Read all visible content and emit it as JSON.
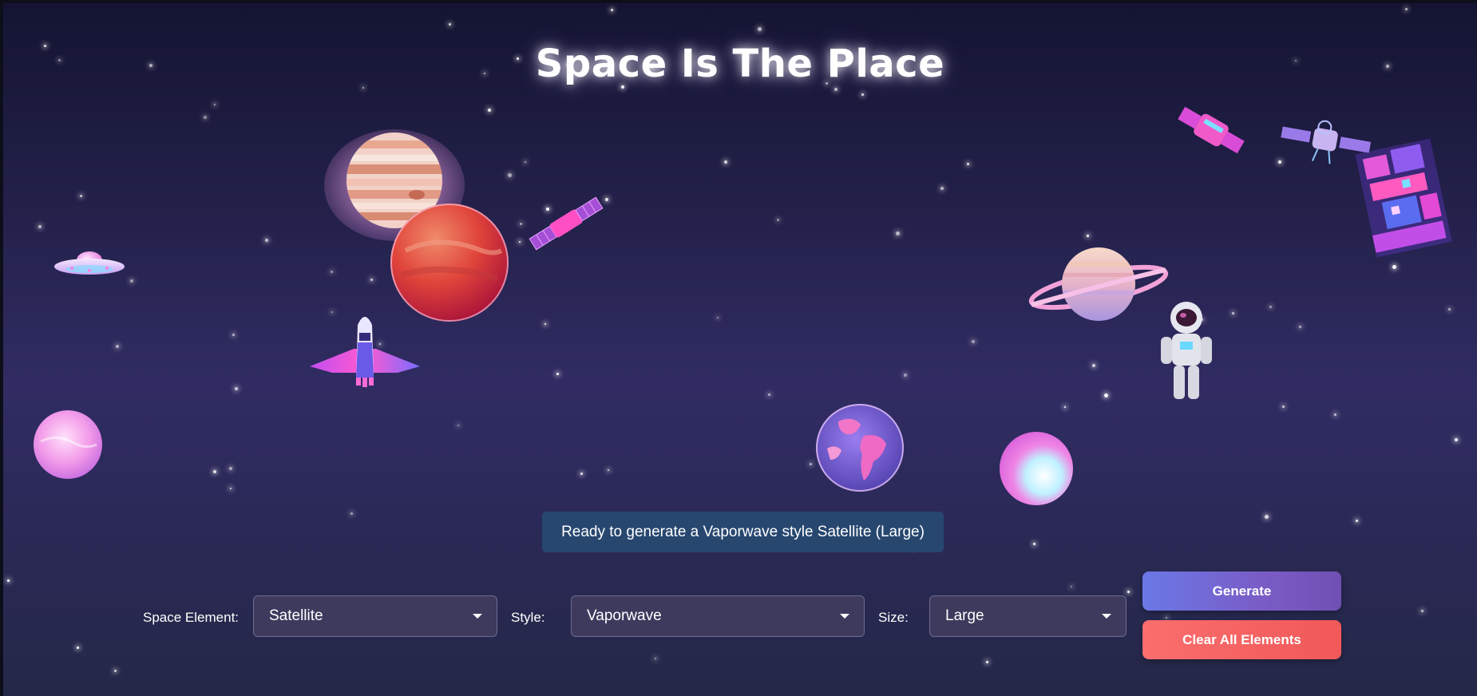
{
  "page": {
    "title": "Space Is The Place"
  },
  "status_message": "Ready to generate a Vaporwave style Satellite (Large)",
  "controls": {
    "element": {
      "label": "Space Element:",
      "value": "Satellite"
    },
    "style": {
      "label": "Style:",
      "value": "Vaporwave"
    },
    "size": {
      "label": "Size:",
      "value": "Large"
    },
    "generate_label": "Generate",
    "clear_label": "Clear All Elements"
  },
  "elements": [
    "ufo",
    "gas-giant-planet",
    "red-planet",
    "satellite",
    "space-shuttle",
    "pink-planet",
    "earth-globe",
    "pink-planet",
    "ringed-planet",
    "astronaut",
    "satellite",
    "satellite",
    "space-station"
  ],
  "colors": {
    "background_top": "#141432",
    "background_mid": "#302c63",
    "status_bg": "#27476f",
    "select_bg": "#3d3a5e",
    "generate_from": "#6a78e6",
    "generate_to": "#7050b4",
    "clear_bg": "#f15858"
  }
}
